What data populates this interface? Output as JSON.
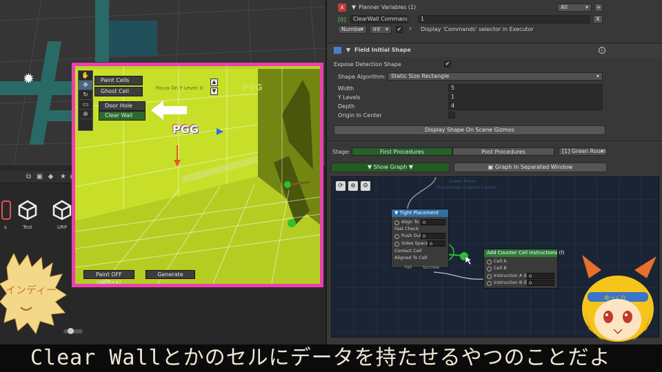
{
  "scene_view": {
    "sun_icon": "directional-light-icon"
  },
  "project_panel": {
    "assets": [
      {
        "label": "s",
        "icon": "package-icon"
      },
      {
        "label": "Test",
        "icon": "unity-icon"
      },
      {
        "label": "URP",
        "icon": "unity-icon"
      }
    ]
  },
  "preview": {
    "tools": [
      "hand-icon",
      "move-icon",
      "rotate-icon",
      "rect-icon",
      "transform-icon"
    ],
    "buttons": {
      "paint_cells": "Paint Cells",
      "ghost_cell": "Ghost Cell",
      "door_hole": "Door Hole",
      "clear_wall": "Clear Wall",
      "paint_off": "Paint OFF (shift+x)",
      "generate": "Generate"
    },
    "focus_label": "Focus On Y Level: 0",
    "logo": "PGG"
  },
  "inspector": {
    "planner_variables": {
      "title": "Planner Variables (1)",
      "filter": "All",
      "index": "[0]",
      "name": "ClearWall Command",
      "value": "1",
      "type1": "Number",
      "type2": "Int",
      "display_hint": "Display 'Commands' selector in Executor",
      "remove": "X",
      "add": "+"
    },
    "field_shape": {
      "title": "Field Initial Shape",
      "expose_label": "Expose Detection Shape",
      "shape_algorithm_label": "Shape Algorithm:",
      "shape_algorithm_value": "Static Size Rectangle",
      "width_label": "Width",
      "width_value": "5",
      "ylevels_label": "Y Levels",
      "ylevels_value": "1",
      "depth_label": "Depth",
      "depth_value": "4",
      "origin_label": "Origin In Center",
      "display_gizmos": "Display Shape On Scene Gizmos"
    },
    "stage": {
      "label": "Stage:",
      "first": "First Procedures",
      "post": "Post Procedures",
      "room": "[1] Green Room",
      "show_graph": "Show Graph",
      "separated": "Graph In Separated Window"
    },
    "graph": {
      "faint_title": "Green Room",
      "faint_sub": "Procedures (Layout Found)",
      "tight": {
        "title": "Tight Placement",
        "ports": [
          {
            "label": "Align To",
            "value": "0"
          },
          {
            "label": "Fast Check",
            "value": ""
          },
          {
            "label": "Push Out",
            "value": "0"
          },
          {
            "label": "Sides Space",
            "value": "0"
          },
          {
            "label": "Contact Cell",
            "value": ""
          },
          {
            "label": "Aligned To Cell",
            "value": ""
          }
        ],
        "fail": "Fail",
        "success": "Success"
      },
      "counter": {
        "title": "Add Counter Cell Instructions (f)",
        "ports": [
          {
            "label": "Cell A",
            "value": ""
          },
          {
            "label": "Cell B",
            "value": ""
          },
          {
            "label": "Instruction A ID",
            "value": "0"
          },
          {
            "label": "Instruction B ID",
            "value": "0"
          }
        ]
      }
    }
  },
  "subtitle": {
    "text": "Clear Wallとかのセルにデータを持たせるやつのことだよ"
  },
  "characters": {
    "left_text": "インディー",
    "right_headband": "ゆっくり"
  }
}
